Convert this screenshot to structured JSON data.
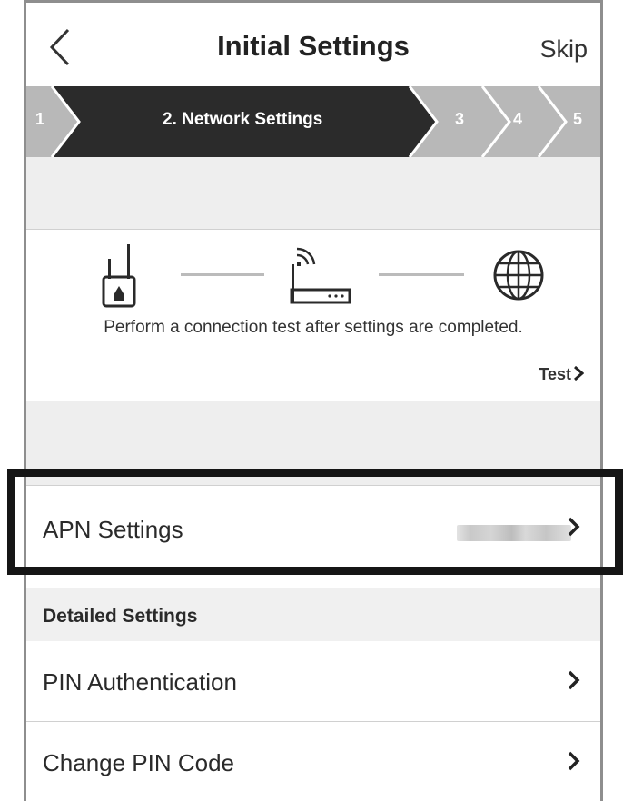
{
  "header": {
    "back_icon": "chevron-left-icon",
    "title": "Initial Settings",
    "skip_label": "Skip"
  },
  "stepper": {
    "steps": [
      {
        "label": "1",
        "state": "done"
      },
      {
        "label": "2. Network Settings",
        "state": "current"
      },
      {
        "label": "3",
        "state": "pending"
      },
      {
        "label": "4",
        "state": "pending"
      },
      {
        "label": "5",
        "state": "pending"
      }
    ],
    "colors": {
      "current": "#2b2b2b",
      "other": "#b8b8b8",
      "text": "#ffffff"
    }
  },
  "diagram": {
    "icons": [
      "mobile-router-icon",
      "wifi-router-icon",
      "globe-icon"
    ],
    "caption": "Perform a connection test after settings are completed.",
    "test_label": "Test",
    "test_icon": "chevron-right-icon"
  },
  "apn_row": {
    "label": "APN Settings",
    "value_note": "blurred",
    "chevron": "chevron-right-icon"
  },
  "detailed": {
    "header": "Detailed Settings",
    "rows": [
      {
        "label": "PIN Authentication",
        "chevron": "chevron-right-icon"
      },
      {
        "label": "Change PIN Code",
        "chevron": "chevron-right-icon"
      }
    ]
  },
  "colors": {
    "highlight_border": "#151515",
    "band_bg": "#eeeeee",
    "divider": "#d0d0d0"
  }
}
